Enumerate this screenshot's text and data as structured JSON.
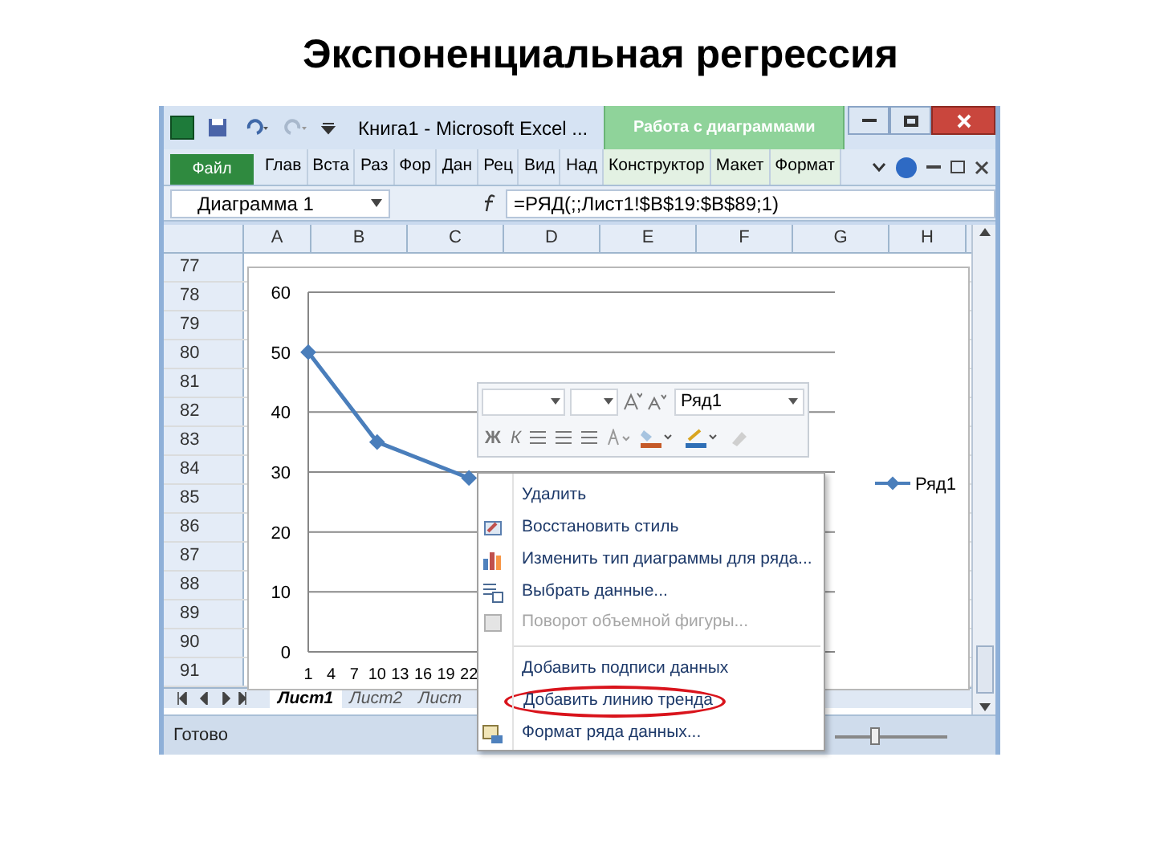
{
  "slide_title": "Экспоненциальная регрессия",
  "window": {
    "title": "Книга1 - Microsoft Excel ...",
    "context_group": "Работа с диаграммами"
  },
  "ribbon_tabs": [
    {
      "label": "Файл",
      "kind": "file",
      "selected": false
    },
    {
      "label": "Глав",
      "kind": "tab",
      "selected": false
    },
    {
      "label": "Вста",
      "kind": "tab",
      "selected": false
    },
    {
      "label": "Раз",
      "kind": "tab",
      "selected": false
    },
    {
      "label": "Фор",
      "kind": "tab",
      "selected": false
    },
    {
      "label": "Дан",
      "kind": "tab",
      "selected": false
    },
    {
      "label": "Рец",
      "kind": "tab",
      "selected": false
    },
    {
      "label": "Вид",
      "kind": "tab",
      "selected": false
    },
    {
      "label": "Над",
      "kind": "tab",
      "selected": false
    },
    {
      "label": "Конструктор",
      "kind": "context",
      "selected": false
    },
    {
      "label": "Макет",
      "kind": "context",
      "selected": false
    },
    {
      "label": "Формат",
      "kind": "context",
      "selected": false
    }
  ],
  "name_box": "Диаграмма 1",
  "formula": "=РЯД(;;Лист1!$B$19:$B$89;1)",
  "columns": [
    "A",
    "B",
    "C",
    "D",
    "E",
    "F",
    "G",
    "H"
  ],
  "rows": [
    "77",
    "78",
    "79",
    "80",
    "81",
    "82",
    "83",
    "84",
    "85",
    "86",
    "87",
    "88",
    "89",
    "90",
    "91"
  ],
  "chart": {
    "chart_data": {
      "type": "line",
      "grid": true,
      "categories": [
        "1",
        "4",
        "7",
        "10",
        "13",
        "16",
        "19",
        "22"
      ],
      "yticks": [
        0,
        10,
        20,
        30,
        40,
        50,
        60
      ],
      "ylim": [
        0,
        60
      ],
      "series": [
        {
          "name": "Ряд1",
          "color": "#4a7ebb",
          "marker": "diamond",
          "values": [
            50,
            null,
            null,
            35,
            null,
            null,
            null,
            29
          ]
        }
      ]
    }
  },
  "mini_toolbar": {
    "series_select": "Ряд1",
    "bold": "Ж",
    "italic": "К"
  },
  "context_menu": [
    {
      "label": "Удалить",
      "disabled": false,
      "circled": false,
      "separator_before": false
    },
    {
      "label": "Восстановить стиль",
      "disabled": false,
      "circled": false,
      "separator_before": false
    },
    {
      "label": "Изменить тип диаграммы для ряда...",
      "disabled": false,
      "circled": false,
      "separator_before": false
    },
    {
      "label": "Выбрать данные...",
      "disabled": false,
      "circled": false,
      "separator_before": false
    },
    {
      "label": "Поворот объемной фигуры...",
      "disabled": true,
      "circled": false,
      "separator_before": false
    },
    {
      "label": "Добавить подписи данных",
      "disabled": false,
      "circled": false,
      "separator_before": true
    },
    {
      "label": "Добавить линию тренда",
      "disabled": false,
      "circled": true,
      "separator_before": false
    },
    {
      "label": "Формат ряда данных...",
      "disabled": false,
      "circled": false,
      "separator_before": false
    }
  ],
  "sheet_tabs": [
    {
      "label": "Лист1",
      "selected": true
    },
    {
      "label": "Лист2",
      "selected": false
    },
    {
      "label": "Лист",
      "selected": false
    }
  ],
  "status_bar": "Готово",
  "zoom_slider": {
    "level": 0.35
  }
}
